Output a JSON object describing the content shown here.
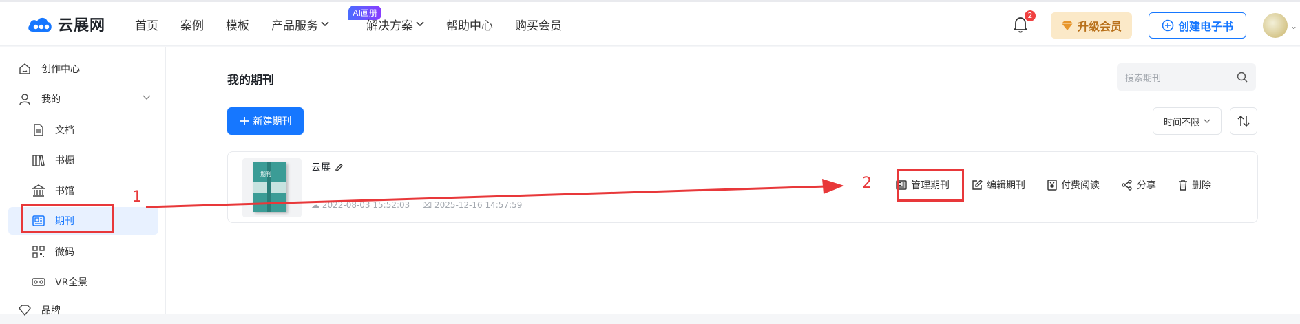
{
  "header": {
    "logo_text": "云展网",
    "nav": [
      {
        "label": "首页"
      },
      {
        "label": "案例"
      },
      {
        "label": "模板"
      },
      {
        "label": "产品服务",
        "badge": "AI画册"
      },
      {
        "label": "解决方案"
      },
      {
        "label": "帮助中心"
      },
      {
        "label": "购买会员"
      }
    ],
    "notification_count": "2",
    "vip_label": "升级会员",
    "create_label": "创建电子书"
  },
  "sidebar": {
    "items": [
      {
        "label": "创作中心"
      },
      {
        "label": "我的"
      },
      {
        "label": "文档"
      },
      {
        "label": "书橱"
      },
      {
        "label": "书馆"
      },
      {
        "label": "期刊"
      },
      {
        "label": "微码"
      },
      {
        "label": "VR全景"
      },
      {
        "label": "品牌"
      }
    ]
  },
  "main": {
    "title": "我的期刊",
    "search_placeholder": "搜索期刊",
    "new_button": "新建期刊",
    "time_filter": "时间不限",
    "card": {
      "title": "云展",
      "cover_label": "期刊",
      "created": "2022-08-03 15:52:03",
      "updated": "2025-12-16 14:57:59",
      "actions": [
        "管理期刊",
        "编辑期刊",
        "付费阅读",
        "分享",
        "删除"
      ]
    }
  },
  "annotations": {
    "step1": "1",
    "step2": "2"
  },
  "colors": {
    "accent": "#1677ff",
    "annotation": "#e8383a",
    "vip_bg": "#fbe9c8"
  }
}
